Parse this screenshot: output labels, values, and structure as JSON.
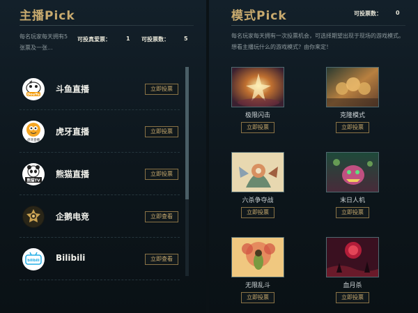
{
  "streamer_section": {
    "title": "主播Pick",
    "description": "每名玩家每天拥有5张票及一张...",
    "real_votes_label": "可投真爱票：",
    "real_votes_value": "1",
    "votes_label": "可投票数：",
    "votes_value": "5",
    "streamers": [
      {
        "name": "斗鱼直播",
        "button": "立即投票",
        "logo_icon": "douyu-logo-icon",
        "logo_text": "DouYu"
      },
      {
        "name": "虎牙直播",
        "button": "立即投票",
        "logo_icon": "huya-logo-icon",
        "logo_text": "虎牙直播"
      },
      {
        "name": "熊猫直播",
        "button": "立即投票",
        "logo_icon": "panda-logo-icon",
        "logo_text": "熊猫TV"
      },
      {
        "name": "企鹅电竞",
        "button": "立即查看",
        "logo_icon": "penguin-esports-logo-icon",
        "logo_text": ""
      },
      {
        "name": "Bilibili",
        "button": "立即查看",
        "logo_icon": "bilibili-logo-icon",
        "logo_text": "bilibili"
      }
    ]
  },
  "mode_section": {
    "title": "模式Pick",
    "votes_label": "可投票数：",
    "votes_value": "0",
    "description": "每名玩家每天拥有一次投票机会，可选择期望出现于现场的游戏模式。想看主播玩什么的游戏模式？由你来定！",
    "modes": [
      {
        "name": "极限闪击",
        "button": "立即投票"
      },
      {
        "name": "克隆模式",
        "button": "立即投票"
      },
      {
        "name": "六杀争夺战",
        "button": "立即投票"
      },
      {
        "name": "末日人机",
        "button": "立即投票"
      },
      {
        "name": "无限乱斗",
        "button": "立即投票"
      },
      {
        "name": "血月杀",
        "button": "立即投票"
      }
    ]
  },
  "colors": {
    "accent_gold": "#c8aa6e",
    "background": "#0b1216",
    "button_border": "#8a7346"
  }
}
